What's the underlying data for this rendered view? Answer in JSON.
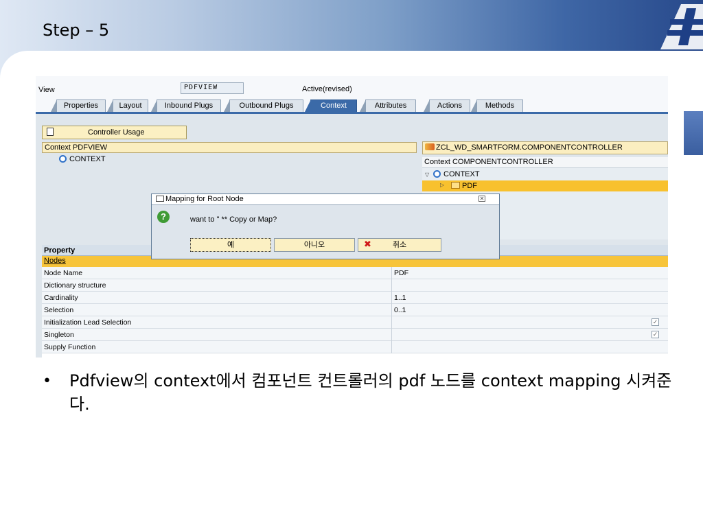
{
  "slide": {
    "title": "Step – 5",
    "bullet": "Pdfview의 context에서 컴포넌트 컨트롤러의 pdf 노드를 context mapping 시켜준다."
  },
  "view": {
    "label": "View",
    "name": "PDFVIEW",
    "status": "Active(revised)"
  },
  "tabs": [
    "Properties",
    "Layout",
    "Inbound Plugs",
    "Outbound Plugs",
    "Context",
    "Attributes",
    "Actions",
    "Methods"
  ],
  "active_tab": "Context",
  "controller_usage_label": "Controller Usage",
  "left_context": {
    "header": "Context PDFVIEW",
    "root": "CONTEXT"
  },
  "right_context": {
    "controller": "ZCL_WD_SMARTFORM.COMPONENTCONTROLLER",
    "header": "Context COMPONENTCONTROLLER",
    "root": "CONTEXT",
    "child": "PDF"
  },
  "property_table": {
    "header": "Property",
    "section": "Nodes",
    "rows": [
      {
        "key": "Node Name",
        "value": "PDF"
      },
      {
        "key": "Dictionary structure",
        "value": ""
      },
      {
        "key": "Cardinality",
        "value": "1..1"
      },
      {
        "key": "Selection",
        "value": "0..1"
      },
      {
        "key": "Initialization Lead Selection",
        "value": "",
        "checked": true
      },
      {
        "key": "Singleton",
        "value": "",
        "checked": true
      },
      {
        "key": "Supply Function",
        "value": ""
      }
    ]
  },
  "dialog": {
    "title": "Mapping for Root Node",
    "message": "want to \" ** Copy or Map?",
    "yes": "예",
    "no": "아니오",
    "cancel": "취소"
  }
}
